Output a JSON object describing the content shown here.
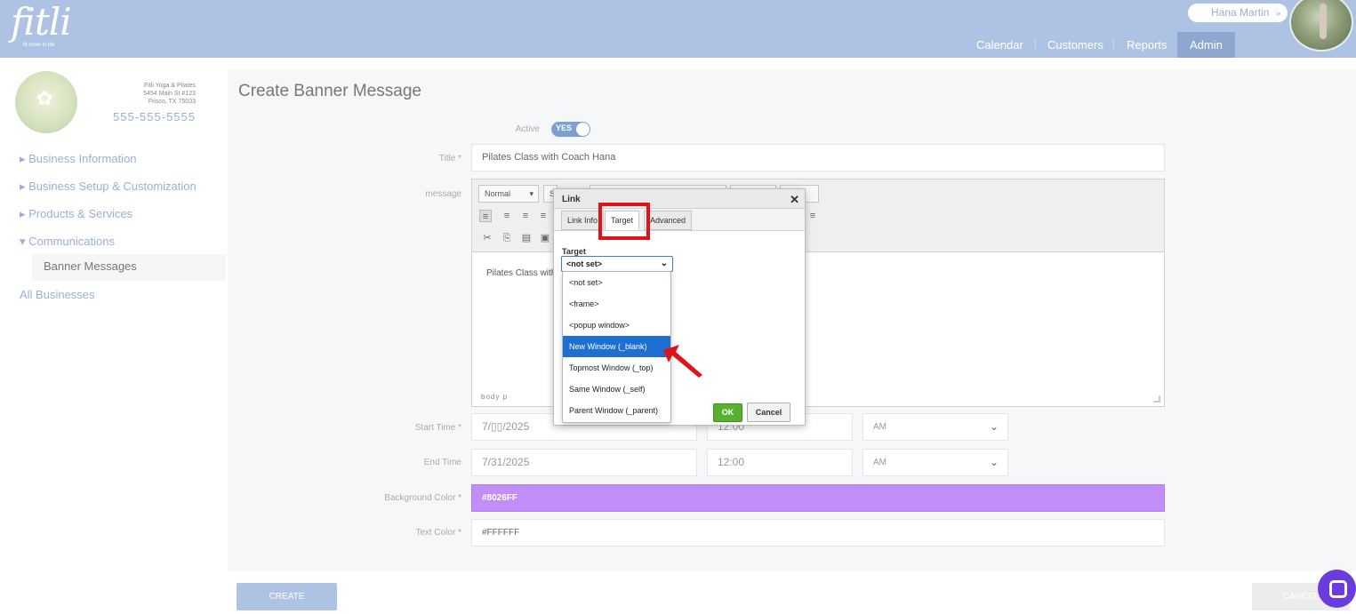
{
  "brand": {
    "logo": "fitli",
    "tagline": "fit more in life"
  },
  "user": {
    "name": "Hana Martin",
    "chevron": "»"
  },
  "nav": {
    "calendar": "Calendar",
    "customers": "Customers",
    "reports": "Reports",
    "admin": "Admin"
  },
  "business": {
    "name": "Fitli Yoga & Pilates",
    "address1": "5454 Main St #123",
    "address2": "Frisco, TX 75033",
    "phone": "555-555-5555"
  },
  "sidebar": {
    "items": [
      {
        "label": "▸ Business Information"
      },
      {
        "label": "▸ Business Setup & Customization"
      },
      {
        "label": "▸ Products & Services"
      },
      {
        "label": "▾ Communications"
      }
    ],
    "sub": "Banner Messages",
    "all": "All Businesses"
  },
  "form": {
    "page_title": "Create Banner Message",
    "active_label": "Active",
    "active_value": "YES",
    "title_label": "Title *",
    "title_value": "Pilates Class with Coach Hana",
    "message_label": "message",
    "start_label": "Start Time *",
    "start_date": "7/▯▯/2025",
    "start_time": "12:00",
    "start_ampm": "AM",
    "end_label": "End Time",
    "end_date": "7/31/2025",
    "end_time": "12:00",
    "end_ampm": "AM",
    "bg_label": "Background Color *",
    "bg_value": "#8026FF",
    "bg_color": "#c18ef8",
    "text_label": "Text Color *",
    "text_value": "#FFFFFF",
    "create": "CREATE",
    "cancel": "CANCEL"
  },
  "editor": {
    "format": "Normal",
    "style_stub": "S",
    "content": "Pilates Class with",
    "path": "body  p"
  },
  "dialog": {
    "title": "Link",
    "close": "✕",
    "tabs": [
      "Link Info",
      "Target",
      "Advanced"
    ],
    "active_tab": "Target",
    "target_label": "Target",
    "target_value": "<not set>",
    "options": [
      "<not set>",
      "<frame>",
      "<popup window>",
      "New Window (_blank)",
      "Topmost Window (_top)",
      "Same Window (_self)",
      "Parent Window (_parent)"
    ],
    "highlighted": "New Window (_blank)",
    "ok": "OK",
    "cancel": "Cancel"
  }
}
